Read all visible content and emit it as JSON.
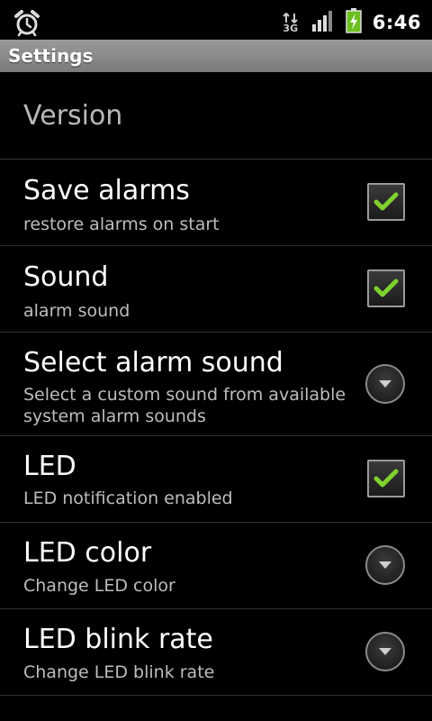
{
  "status_bar": {
    "time": "6:46",
    "network_label": "3G",
    "icons": [
      "alarm-clock-icon",
      "data-arrows-icon",
      "signal-bars-icon",
      "battery-charging-icon"
    ]
  },
  "header": {
    "title": "Settings"
  },
  "settings": {
    "category": "Version",
    "items": [
      {
        "title": "Save alarms",
        "summary": "restore alarms on start",
        "widget": "checkbox",
        "checked": true
      },
      {
        "title": "Sound",
        "summary": "alarm sound",
        "widget": "checkbox",
        "checked": true
      },
      {
        "title": "Select alarm sound",
        "summary": "Select a custom sound from available system alarm sounds",
        "widget": "dropdown"
      },
      {
        "title": "LED",
        "summary": "LED notification enabled",
        "widget": "checkbox",
        "checked": true
      },
      {
        "title": "LED color",
        "summary": "Change LED color",
        "widget": "dropdown"
      },
      {
        "title": "LED blink rate",
        "summary": "Change LED blink rate",
        "widget": "dropdown"
      }
    ]
  },
  "colors": {
    "check_green": "#7fd12f",
    "title_bar": "#8a8a8a",
    "summary_text": "#bdbdbd"
  }
}
